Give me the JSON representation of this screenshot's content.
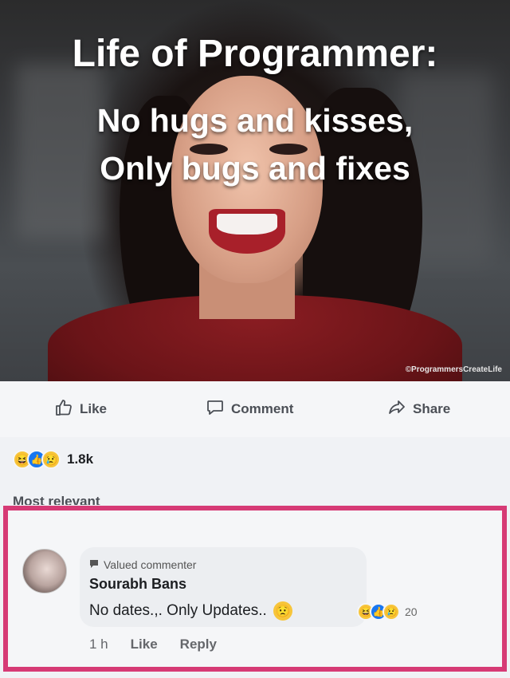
{
  "meme": {
    "title": "Life of Programmer:",
    "line1": "No hugs and kisses,",
    "line2": "Only bugs and fixes",
    "watermark": "©ProgrammersCreateLife"
  },
  "actions": {
    "like": "Like",
    "comment": "Comment",
    "share": "Share"
  },
  "reactions": {
    "icons": [
      "haha-icon",
      "like-icon",
      "sad-icon"
    ],
    "count": "1.8k"
  },
  "sort": {
    "label": "Most relevant"
  },
  "comment": {
    "badge": "Valued commenter",
    "author": "Sourabh Bans",
    "text": "No dates.,. Only Updates..",
    "reaction_count": "20",
    "time": "1 h",
    "like": "Like",
    "reply": "Reply"
  },
  "colors": {
    "highlight_border": "#d63a75",
    "facebook_blue": "#1877f2"
  }
}
